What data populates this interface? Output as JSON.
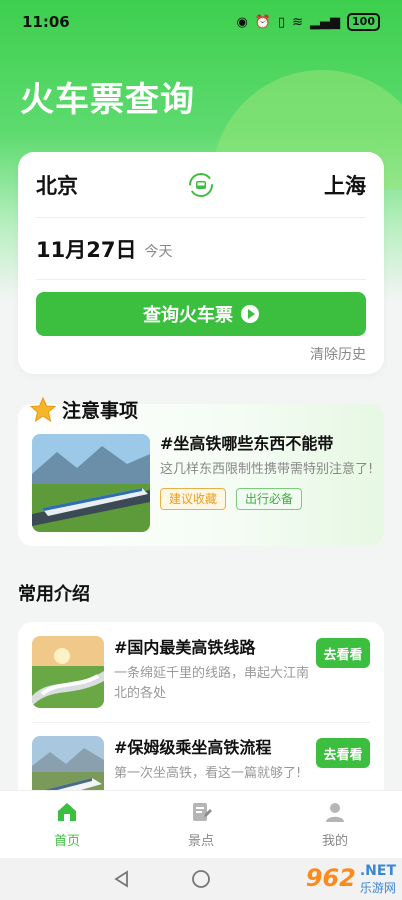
{
  "status": {
    "time": "11:06",
    "battery": "100"
  },
  "page_title": "火车票查询",
  "query": {
    "from_city": "北京",
    "to_city": "上海",
    "date": "11月27日",
    "date_sub": "今天",
    "search_label": "查询火车票",
    "clear_history": "清除历史"
  },
  "notice": {
    "title": "注意事项",
    "article_title": "#坐高铁哪些东西不能带",
    "article_desc": "这几样东西限制性携带需特别注意了!",
    "tags": [
      "建议收藏",
      "出行必备"
    ]
  },
  "intro": {
    "title": "常用介绍",
    "items": [
      {
        "title": "#国内最美高铁线路",
        "desc": "一条绵延千里的线路，串起大江南北的各处",
        "button": "去看看"
      },
      {
        "title": "#保姆级乘坐高铁流程",
        "desc": "第一次坐高铁，看这一篇就够了!",
        "button": "去看看"
      }
    ]
  },
  "tabbar": {
    "items": [
      {
        "label": "首页",
        "icon": "home-icon",
        "active": true
      },
      {
        "label": "景点",
        "icon": "edit-doc-icon",
        "active": false
      },
      {
        "label": "我的",
        "icon": "user-icon",
        "active": false
      }
    ]
  },
  "watermark": {
    "number": "962",
    "net": ".NET",
    "name": "乐游网"
  },
  "colors": {
    "primary": "#3cbf3f",
    "header": "#3dcf4e"
  }
}
